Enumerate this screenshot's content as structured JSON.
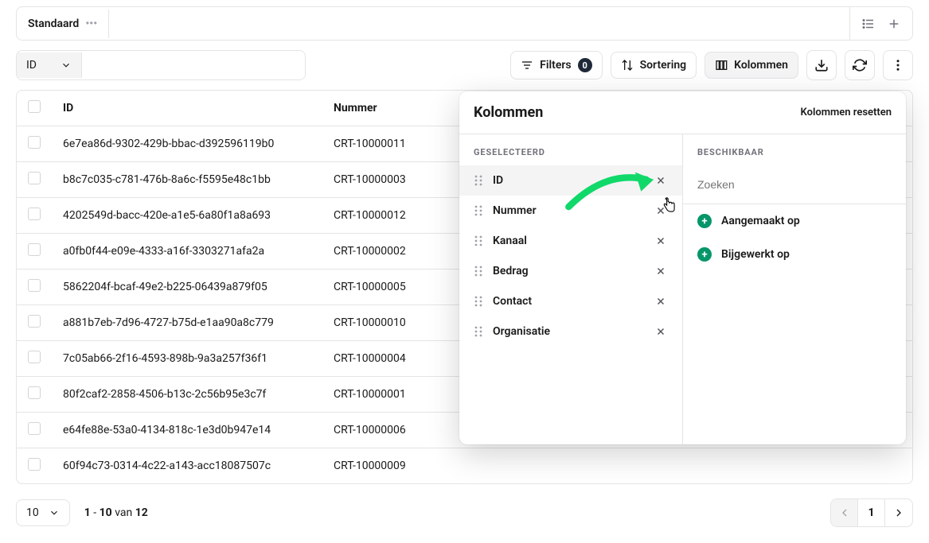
{
  "tabs": {
    "active": "Standaard"
  },
  "toolbar": {
    "field_select": "ID",
    "filters_label": "Filters",
    "filters_count": "0",
    "sort_label": "Sortering",
    "columns_label": "Kolommen"
  },
  "table": {
    "headers": {
      "id": "ID",
      "nummer": "Nummer"
    },
    "rows": [
      {
        "id": "6e7ea86d-9302-429b-bbac-d392596119b0",
        "nummer": "CRT-10000011"
      },
      {
        "id": "b8c7c035-c781-476b-8a6c-f5595e48c1bb",
        "nummer": "CRT-10000003"
      },
      {
        "id": "4202549d-bacc-420e-a1e5-6a80f1a8a693",
        "nummer": "CRT-10000012"
      },
      {
        "id": "a0fb0f44-e09e-4333-a16f-3303271afa2a",
        "nummer": "CRT-10000002"
      },
      {
        "id": "5862204f-bcaf-49e2-b225-06439a879f05",
        "nummer": "CRT-10000005"
      },
      {
        "id": "a881b7eb-7d96-4727-b75d-e1aa90a8c779",
        "nummer": "CRT-10000010"
      },
      {
        "id": "7c05ab66-2f16-4593-898b-9a3a257f36f1",
        "nummer": "CRT-10000004"
      },
      {
        "id": "80f2caf2-2858-4506-b13c-2c56b95e3c7f",
        "nummer": "CRT-10000001"
      },
      {
        "id": "e64fe88e-53a0-4134-818c-1e3d0b947e14",
        "nummer": "CRT-10000006"
      },
      {
        "id": "60f94c73-0314-4c22-a143-acc18087507c",
        "nummer": "CRT-10000009"
      }
    ]
  },
  "popover": {
    "title": "Kolommen",
    "reset": "Kolommen resetten",
    "selected_header": "GESELECTEERD",
    "available_header": "BESCHIKBAAR",
    "search_placeholder": "Zoeken",
    "selected": [
      {
        "label": "ID",
        "active": true
      },
      {
        "label": "Nummer"
      },
      {
        "label": "Kanaal"
      },
      {
        "label": "Bedrag"
      },
      {
        "label": "Contact"
      },
      {
        "label": "Organisatie"
      }
    ],
    "available": [
      {
        "label": "Aangemaakt op"
      },
      {
        "label": "Bijgewerkt op"
      }
    ]
  },
  "footer": {
    "page_size": "10",
    "range_from": "1",
    "range_to": "10",
    "range_sep": "van",
    "total": "12",
    "current_page": "1"
  }
}
